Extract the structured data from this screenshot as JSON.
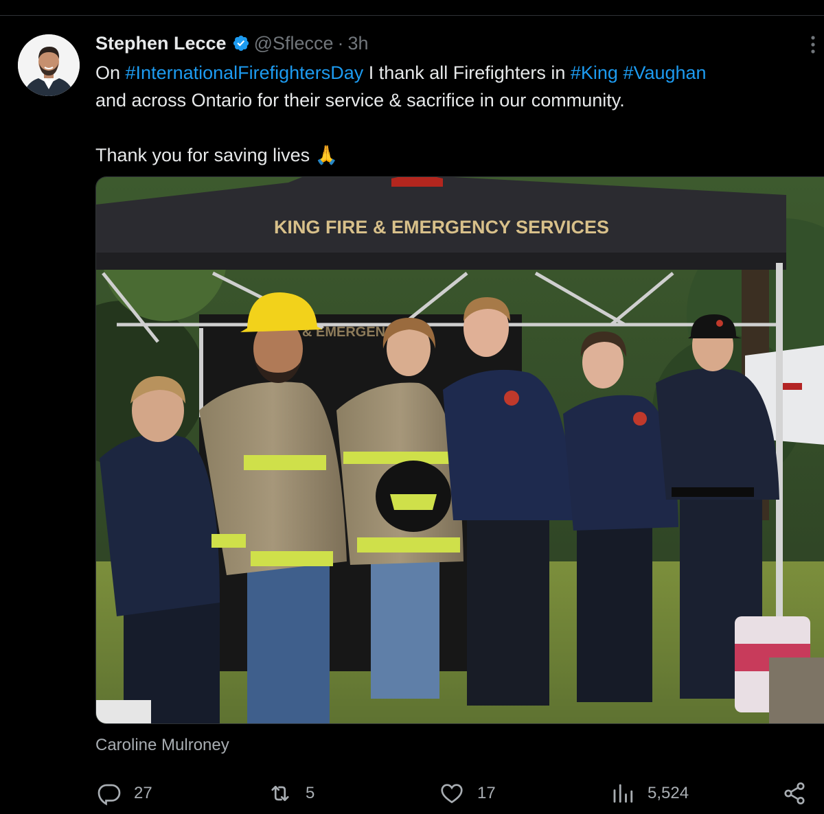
{
  "tweet": {
    "display_name": "Stephen Lecce",
    "handle": "@Sflecce",
    "separator": "·",
    "time": "3h",
    "verified_icon": "verified-badge-icon",
    "text": {
      "line1_prefix": "On ",
      "hashtag1": "#InternationalFirefightersDay",
      "line1_middle": " I thank all Firefighters in ",
      "hashtag2": "#King",
      "hashtag3": "#Vaughan",
      "line2": "and across Ontario for their service & sacrifice in our community.",
      "line3": "Thank you for saving lives 🙏"
    },
    "media": {
      "tent_banner": "KING FIRE & EMERGENCY SERVICES"
    },
    "tagged_user": "Caroline Mulroney",
    "actions": {
      "replies": "27",
      "reposts": "5",
      "likes": "17",
      "views": "5,524"
    }
  },
  "colors": {
    "background": "#000000",
    "text_primary": "#e7e9ea",
    "text_secondary": "#71767b",
    "link": "#1d9bf0",
    "verified": "#1d9bf0",
    "tent_banner_text": "#d8c08a"
  }
}
